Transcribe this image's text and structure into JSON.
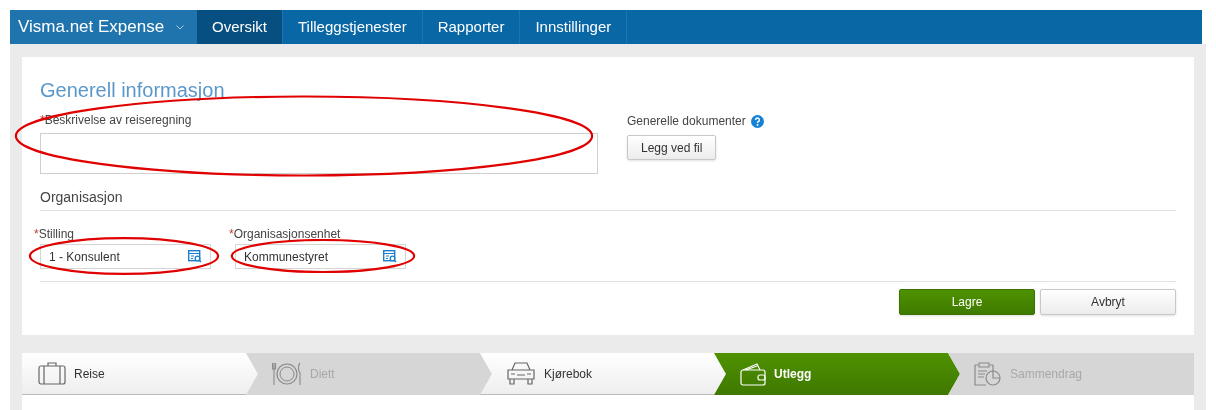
{
  "nav": {
    "brand": "Visma.net Expense",
    "tabs": [
      {
        "label": "Oversikt",
        "selected": true
      },
      {
        "label": "Tilleggstjenester",
        "selected": false
      },
      {
        "label": "Rapporter",
        "selected": false
      },
      {
        "label": "Innstillinger",
        "selected": false
      }
    ]
  },
  "form": {
    "title": "Generell informasjon",
    "description": {
      "label": "Beskrivelse av reiseregning",
      "required_mark": "*",
      "circled": true
    },
    "documents": {
      "label": "Generelle dokumenter",
      "button": "Legg ved fil"
    },
    "organisation": {
      "heading": "Organisasjon",
      "fields": [
        {
          "label": "Stilling",
          "value": "1 - Konsulent",
          "required_mark": "*",
          "circled": true
        },
        {
          "label": "Organisasjonsenhet",
          "value": "Kommunestyret",
          "required_mark": "*",
          "circled": true
        }
      ]
    },
    "buttons": [
      {
        "label": "Lagre",
        "kind": "primary"
      },
      {
        "label": "Avbryt",
        "kind": "secondary"
      }
    ]
  },
  "steps": [
    {
      "label": "Reise",
      "selected": false,
      "disabled": false
    },
    {
      "label": "Diett",
      "selected": false,
      "disabled": true
    },
    {
      "label": "Kjørebok",
      "selected": false,
      "disabled": false
    },
    {
      "label": "Utlegg",
      "selected": true,
      "disabled": false
    },
    {
      "label": "Sammendrag",
      "selected": false,
      "disabled": true
    }
  ]
}
